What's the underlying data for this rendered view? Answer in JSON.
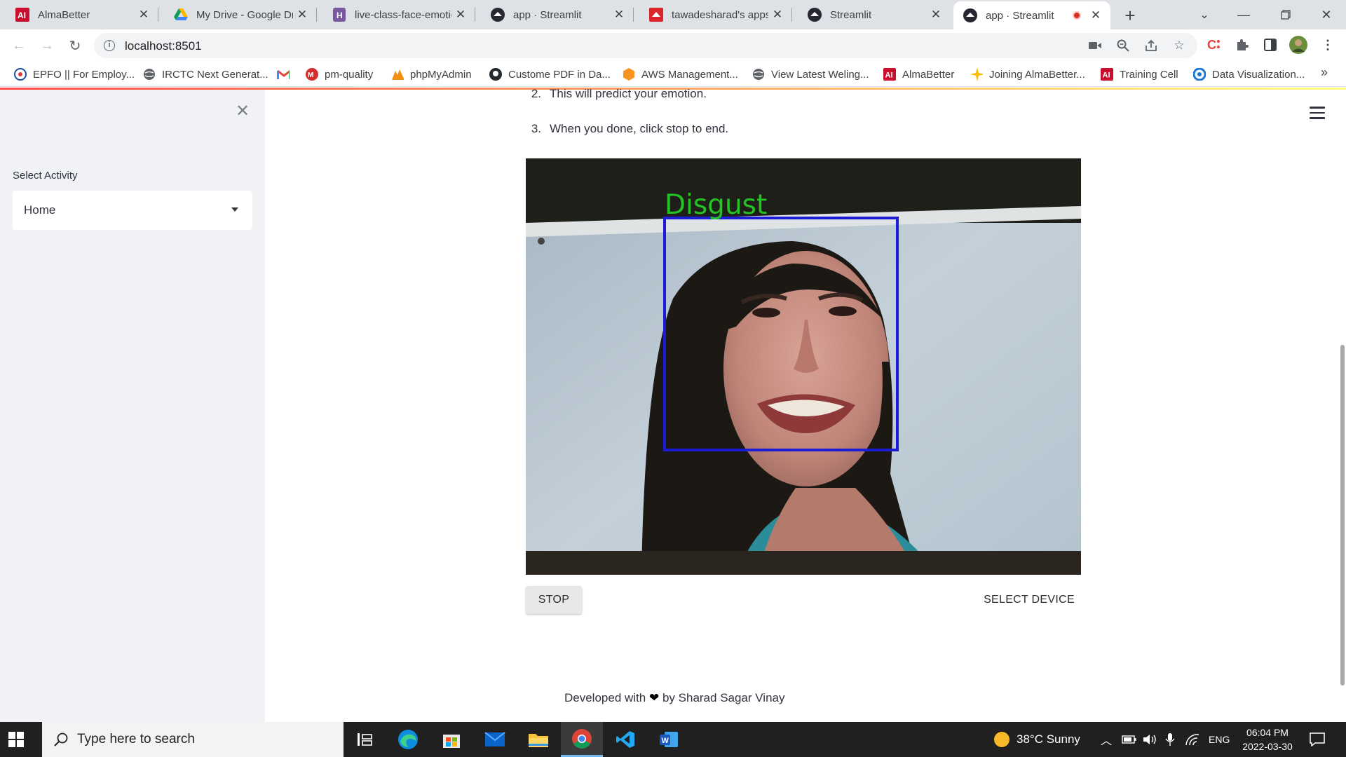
{
  "browser": {
    "tabs": [
      {
        "title": "AlmaBetter",
        "icon": "almabetter-logo-icon",
        "color": "#c8102e"
      },
      {
        "title": "My Drive - Google Dri",
        "icon": "google-drive-icon",
        "color": "#1fa463"
      },
      {
        "title": "live-class-face-emotic",
        "icon": "heroku-icon",
        "color": "#79589f"
      },
      {
        "title": "app · Streamlit",
        "icon": "streamlit-icon",
        "color": "#262730"
      },
      {
        "title": "tawadesharad's apps",
        "icon": "streamlit-cloud-icon",
        "color": "#d8262b"
      },
      {
        "title": "Streamlit",
        "icon": "streamlit-icon",
        "color": "#262730"
      },
      {
        "title": "app · Streamlit",
        "icon": "streamlit-icon",
        "color": "#262730",
        "recording": true
      }
    ],
    "url": "localhost:8501",
    "bookmarks": [
      {
        "label": "EPFO || For Employ...",
        "icon": "epfo-icon"
      },
      {
        "label": "IRCTC Next Generat...",
        "icon": "globe-icon"
      },
      {
        "label": "",
        "icon": "gmail-icon"
      },
      {
        "label": "pm-quality",
        "icon": "pm-quality-icon"
      },
      {
        "label": "phpMyAdmin",
        "icon": "phpmyadmin-icon"
      },
      {
        "label": "Custome PDF in Da...",
        "icon": "github-icon"
      },
      {
        "label": "AWS Management...",
        "icon": "aws-icon"
      },
      {
        "label": "View Latest Weling...",
        "icon": "globe-icon"
      },
      {
        "label": "AlmaBetter",
        "icon": "almabetter-logo-icon"
      },
      {
        "label": "Joining AlmaBetter...",
        "icon": "sparkle-icon"
      },
      {
        "label": "Training Cell",
        "icon": "almabetter-logo-icon"
      },
      {
        "label": "Data Visualization...",
        "icon": "data-viz-icon"
      }
    ]
  },
  "sidebar": {
    "label": "Select Activity",
    "selected": "Home"
  },
  "main": {
    "steps": [
      {
        "num": "2.",
        "text": "This will predict your emotion."
      },
      {
        "num": "3.",
        "text": "When you done, click stop to end."
      }
    ],
    "video": {
      "emotion_label": "Disgust",
      "label_color": "#22c322",
      "box_color": "#1c1cd8"
    },
    "stop_label": "STOP",
    "select_device_label": "SELECT DEVICE",
    "footer": {
      "prefix": "Developed with",
      "heart": "❤",
      "suffix": "by Sharad Sagar Vinay"
    }
  },
  "taskbar": {
    "search_placeholder": "Type here to search",
    "weather": "38°C  Sunny",
    "language": "ENG",
    "time": "06:04 PM",
    "date": "2022-03-30"
  },
  "colors": {
    "sidebar_bg": "#f0f2f6",
    "text": "#31333f",
    "accent": "#ff4b4b"
  }
}
